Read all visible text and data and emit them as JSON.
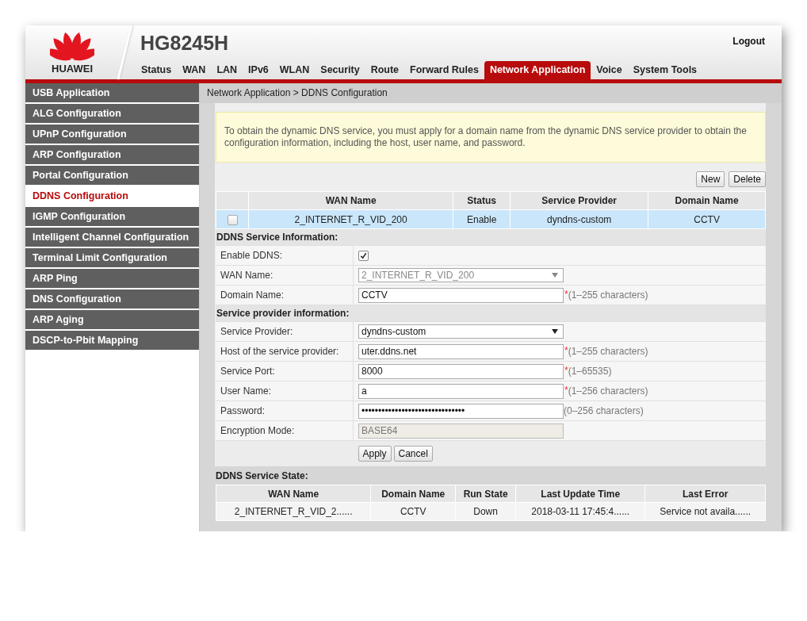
{
  "header": {
    "logo_text": "HUAWEI",
    "model": "HG8245H",
    "logout": "Logout"
  },
  "tabs": [
    {
      "label": "Status",
      "selected": false
    },
    {
      "label": "WAN",
      "selected": false
    },
    {
      "label": "LAN",
      "selected": false
    },
    {
      "label": "IPv6",
      "selected": false
    },
    {
      "label": "WLAN",
      "selected": false
    },
    {
      "label": "Security",
      "selected": false
    },
    {
      "label": "Route",
      "selected": false
    },
    {
      "label": "Forward Rules",
      "selected": false
    },
    {
      "label": "Network Application",
      "selected": true
    },
    {
      "label": "Voice",
      "selected": false
    },
    {
      "label": "System Tools",
      "selected": false
    }
  ],
  "sidebar": {
    "items": [
      {
        "label": "USB Application",
        "selected": false
      },
      {
        "label": "ALG Configuration",
        "selected": false
      },
      {
        "label": "UPnP Configuration",
        "selected": false
      },
      {
        "label": "ARP Configuration",
        "selected": false
      },
      {
        "label": "Portal Configuration",
        "selected": false
      },
      {
        "label": "DDNS Configuration",
        "selected": true
      },
      {
        "label": "IGMP Configuration",
        "selected": false
      },
      {
        "label": "Intelligent Channel Configuration",
        "selected": false
      },
      {
        "label": "Terminal Limit Configuration",
        "selected": false
      },
      {
        "label": "ARP Ping",
        "selected": false
      },
      {
        "label": "DNS Configuration",
        "selected": false
      },
      {
        "label": "ARP Aging",
        "selected": false
      },
      {
        "label": "DSCP-to-Pbit Mapping",
        "selected": false
      }
    ]
  },
  "breadcrumb": "Network Application > DDNS Configuration",
  "notice": "To obtain the dynamic DNS service, you must apply for a domain name from the dynamic DNS service provider to obtain the configuration information, including the host, user name, and password.",
  "toolbar_buttons": [
    "New",
    "Delete"
  ],
  "ddns_table": {
    "columns": [
      "WAN Name",
      "Status",
      "Service Provider",
      "Domain Name"
    ],
    "rows": [
      {
        "checked": false,
        "selected": true,
        "cells": [
          "2_INTERNET_R_VID_200",
          "Enable",
          "dyndns-custom",
          "CCTV"
        ]
      }
    ]
  },
  "sections": [
    {
      "title": "DDNS Service Information:",
      "fields": [
        {
          "kind": "checkbox",
          "label": "Enable DDNS:",
          "checked": true
        },
        {
          "kind": "select",
          "label": "WAN Name:",
          "value": "2_INTERNET_R_VID_200",
          "disabled": true
        },
        {
          "kind": "text",
          "label": "Domain Name:",
          "value": "CCTV",
          "mark": "*",
          "hint": "(1–255 characters)"
        }
      ]
    },
    {
      "title": "Service provider information:",
      "fields": [
        {
          "kind": "select",
          "label": "Service Provider:",
          "value": "dyndns-custom",
          "disabled": false
        },
        {
          "kind": "text",
          "label": "Host of the service provider:",
          "value": "uter.ddns.net",
          "mark": "*",
          "hint": "(1–255 characters)"
        },
        {
          "kind": "text",
          "label": "Service Port:",
          "value": "8000",
          "mark": "*",
          "hint": "(1–65535)"
        },
        {
          "kind": "text",
          "label": "User Name:",
          "value": "a",
          "mark": "*",
          "hint": "(1–256 characters)"
        },
        {
          "kind": "text",
          "label": "Password:",
          "value": "•••••••••••••••••••••••••••••••",
          "hint": "(0–256 characters)"
        },
        {
          "kind": "readonly",
          "label": "Encryption Mode:",
          "value": "BASE64"
        }
      ]
    }
  ],
  "form_buttons": [
    "Apply",
    "Cancel"
  ],
  "state": {
    "title": "DDNS Service State:",
    "columns": [
      "WAN Name",
      "Domain Name",
      "Run State",
      "Last Update Time",
      "Last Error"
    ],
    "rows": [
      [
        "2_INTERNET_R_VID_2......",
        "CCTV",
        "Down",
        "2018-03-11 17:45:4......",
        "Service not availa......"
      ]
    ]
  }
}
